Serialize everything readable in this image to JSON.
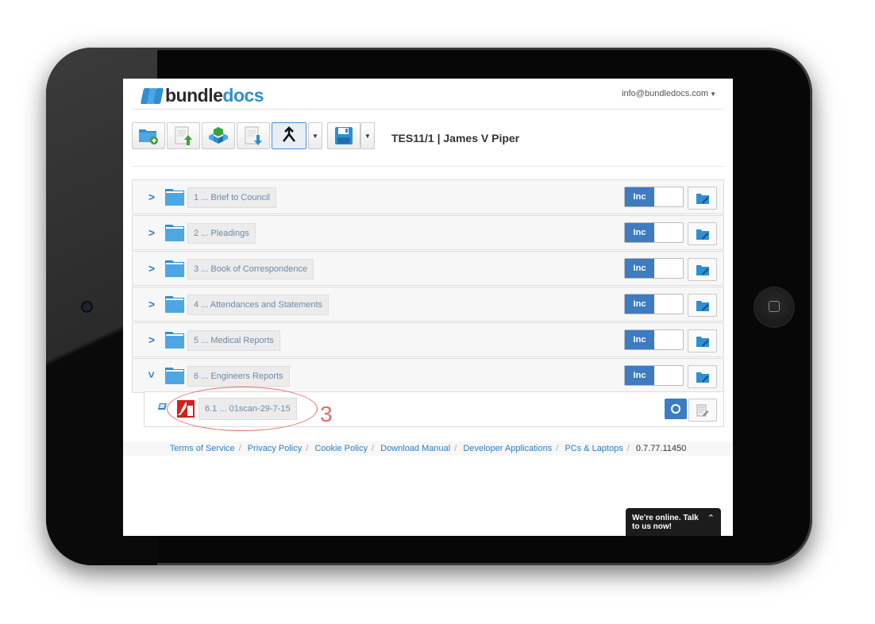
{
  "header": {
    "logo_part1": "bundle",
    "logo_part2": "docs",
    "user_email": "info@bundledocs.com"
  },
  "toolbar": {
    "case_title": "TES11/1 | James V Piper"
  },
  "sections": [
    {
      "label": "1 ... Brief to Council",
      "toggle": "Inc",
      "expanded": false
    },
    {
      "label": "2 ... Pleadings",
      "toggle": "Inc",
      "expanded": false
    },
    {
      "label": "3 ... Book of Correspondence",
      "toggle": "Inc",
      "expanded": false
    },
    {
      "label": "4 ... Attendances and Statements",
      "toggle": "Inc",
      "expanded": false
    },
    {
      "label": "5 ... Medical Reports",
      "toggle": "Inc",
      "expanded": false
    },
    {
      "label": "6 ... Engineers Reports",
      "toggle": "Inc",
      "expanded": true
    }
  ],
  "document": {
    "label": "6.1 ... 01scan-29-7-15"
  },
  "annotation": {
    "number": "3"
  },
  "footer": {
    "links": [
      "Terms of Service",
      "Privacy Policy",
      "Cookie Policy",
      "Download Manual",
      "Developer Applications",
      "PCs & Laptops"
    ],
    "version": "0.7.77.11450"
  },
  "chat": {
    "text": "We're online. Talk to us now!"
  },
  "colors": {
    "brand_blue": "#2f8fd3",
    "toggle_blue": "#3d7cc1",
    "annotation_red": "#e86a6a"
  }
}
